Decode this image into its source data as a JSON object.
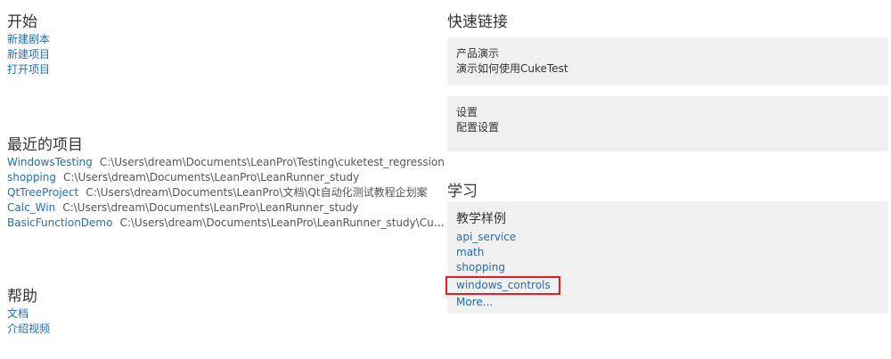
{
  "start": {
    "title": "开始",
    "links": [
      "新建剧本",
      "新建项目",
      "打开项目"
    ]
  },
  "recent": {
    "title": "最近的项目",
    "items": [
      {
        "name": "WindowsTesting",
        "path": "C:\\Users\\dream\\Documents\\LeanPro\\Testing\\cuketest_regression"
      },
      {
        "name": "shopping",
        "path": "C:\\Users\\dream\\Documents\\LeanPro\\LeanRunner_study"
      },
      {
        "name": "QtTreeProject",
        "path": "C:\\Users\\dream\\Documents\\LeanPro\\文档\\Qt自动化测试教程企划案"
      },
      {
        "name": "Calc_Win",
        "path": "C:\\Users\\dream\\Documents\\LeanPro\\LeanRunner_study"
      },
      {
        "name": "BasicFunctionDemo",
        "path": "C:\\Users\\dream\\Documents\\LeanPro\\LeanRunner_study\\CukeTest_Re..."
      }
    ]
  },
  "help": {
    "title": "帮助",
    "links": [
      "文档",
      "介绍视频"
    ]
  },
  "quicklinks": {
    "title": "快速链接",
    "cards": [
      {
        "title": "产品演示",
        "desc": "演示如何使用CukeTest"
      },
      {
        "title": "设置",
        "desc": "配置设置"
      }
    ]
  },
  "learn": {
    "title": "学习",
    "card_title": "教学样例",
    "links": [
      "api_service",
      "math",
      "shopping",
      "windows_controls",
      "More..."
    ],
    "highlight_color": "#e02020"
  },
  "colors": {
    "link": "#1f6fb8",
    "card_bg": "#f0f0f0"
  }
}
